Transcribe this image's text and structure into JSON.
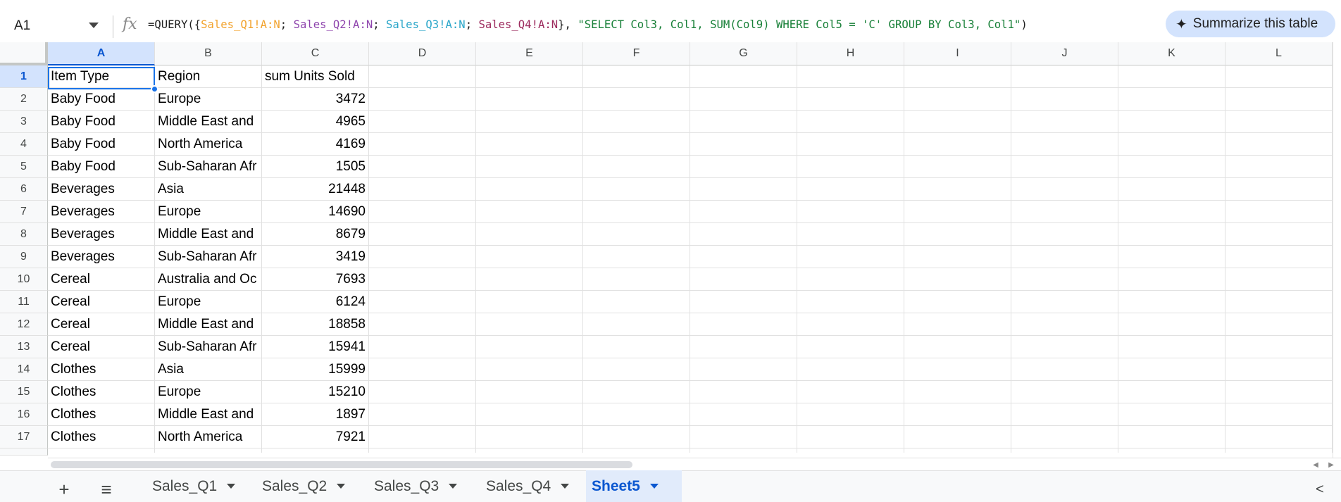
{
  "namebox": {
    "value": "A1"
  },
  "formula": {
    "prefix": "=QUERY({",
    "q1": "Sales_Q1!A:N",
    "q2": "Sales_Q2!A:N",
    "q3": "Sales_Q3!A:N",
    "q4": "Sales_Q4!A:N",
    "sep": "; ",
    "mid": "}, ",
    "query": "\"SELECT Col3, Col1, SUM(Col9) WHERE Col5 = 'C' GROUP BY Col3, Col1\"",
    "suffix": ")"
  },
  "summarize_button": {
    "label": "Summarize this table",
    "icon": "sparkle-icon"
  },
  "columns": [
    "A",
    "B",
    "C",
    "D",
    "E",
    "F",
    "G",
    "H",
    "I",
    "J",
    "K",
    "L"
  ],
  "rows": [
    {
      "n": "1",
      "a": "Item Type",
      "b": "Region",
      "c": "sum Units Sold"
    },
    {
      "n": "2",
      "a": "Baby Food",
      "b": "Europe",
      "c": "3472"
    },
    {
      "n": "3",
      "a": "Baby Food",
      "b": "Middle East and",
      "c": "4965"
    },
    {
      "n": "4",
      "a": "Baby Food",
      "b": "North America",
      "c": "4169"
    },
    {
      "n": "5",
      "a": "Baby Food",
      "b": "Sub-Saharan Afr",
      "c": "1505"
    },
    {
      "n": "6",
      "a": "Beverages",
      "b": "Asia",
      "c": "21448"
    },
    {
      "n": "7",
      "a": "Beverages",
      "b": "Europe",
      "c": "14690"
    },
    {
      "n": "8",
      "a": "Beverages",
      "b": "Middle East and",
      "c": "8679"
    },
    {
      "n": "9",
      "a": "Beverages",
      "b": "Sub-Saharan Afr",
      "c": "3419"
    },
    {
      "n": "10",
      "a": "Cereal",
      "b": "Australia and Oc",
      "c": "7693"
    },
    {
      "n": "11",
      "a": "Cereal",
      "b": "Europe",
      "c": "6124"
    },
    {
      "n": "12",
      "a": "Cereal",
      "b": "Middle East and",
      "c": "18858"
    },
    {
      "n": "13",
      "a": "Cereal",
      "b": "Sub-Saharan Afr",
      "c": "15941"
    },
    {
      "n": "14",
      "a": "Clothes",
      "b": "Asia",
      "c": "15999"
    },
    {
      "n": "15",
      "a": "Clothes",
      "b": "Europe",
      "c": "15210"
    },
    {
      "n": "16",
      "a": "Clothes",
      "b": "Middle East and",
      "c": "1897"
    },
    {
      "n": "17",
      "a": "Clothes",
      "b": "North America",
      "c": "7921"
    }
  ],
  "sheet_tabs": [
    {
      "label": "Sales_Q1",
      "active": false
    },
    {
      "label": "Sales_Q2",
      "active": false
    },
    {
      "label": "Sales_Q3",
      "active": false
    },
    {
      "label": "Sales_Q4",
      "active": false
    },
    {
      "label": "Sheet5",
      "active": true
    }
  ],
  "toolbar": {
    "add_sheet": "+",
    "all_sheets": "≡",
    "collapse": "<"
  }
}
